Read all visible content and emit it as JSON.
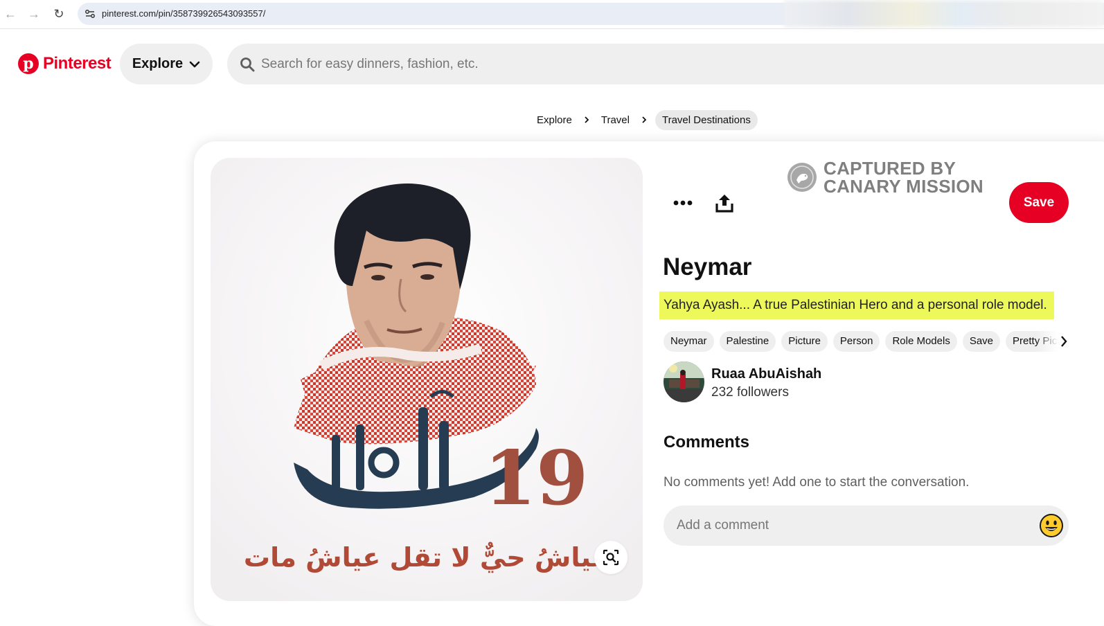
{
  "browser": {
    "url": "pinterest.com/pin/358739926543093557/"
  },
  "header": {
    "logo_text": "Pinterest",
    "explore_label": "Explore",
    "search_placeholder": "Search for easy dinners, fashion, etc."
  },
  "breadcrumb": [
    "Explore",
    "Travel",
    "Travel Destinations"
  ],
  "image": {
    "number_text": "19",
    "arabic_name": "المهندس",
    "arabic_caption": "عياشُ حيٌّ لا تقل عياشُ مات"
  },
  "watermark": {
    "line1": "CAPTURED BY",
    "line2": "CANARY MISSION"
  },
  "pin": {
    "save_label": "Save",
    "title": "Neymar",
    "description": "Yahya Ayash... A true Palestinian Hero and a personal role model.",
    "tags": [
      "Neymar",
      "Palestine",
      "Picture",
      "Person",
      "Role Models",
      "Save",
      "Pretty Pictures"
    ]
  },
  "user": {
    "name": "Ruaa AbuAishah",
    "followers": "232 followers"
  },
  "comments": {
    "heading": "Comments",
    "empty_text": "No comments yet! Add one to start the conversation.",
    "input_placeholder": "Add a comment"
  },
  "colors": {
    "brand": "#e60023",
    "highlight": "#edf95a"
  }
}
